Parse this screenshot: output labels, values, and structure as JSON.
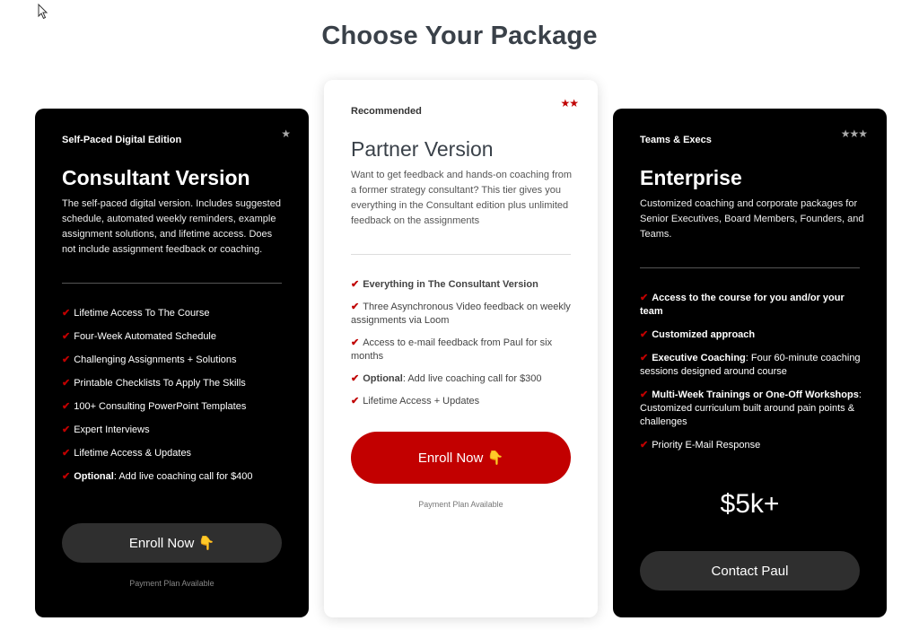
{
  "page": {
    "title": "Choose Your Package"
  },
  "colors": {
    "accent_red": "#c20000",
    "dark_card": "#000000",
    "button_gray": "#2f2f2f"
  },
  "cards": {
    "consultant": {
      "tier": "Self-Paced Digital Edition",
      "stars": "★",
      "title": "Consultant Version",
      "description": "The self-paced digital version. Includes suggested schedule, automated weekly reminders, example assignment solutions, and lifetime access. Does not include assignment feedback or coaching.",
      "features": [
        {
          "bold": "",
          "text": "Lifetime Access To The Course"
        },
        {
          "bold": "",
          "text": "Four-Week Automated Schedule"
        },
        {
          "bold": "",
          "text": "Challenging Assignments + Solutions"
        },
        {
          "bold": "",
          "text": "Printable Checklists To Apply The Skills"
        },
        {
          "bold": "",
          "text": "100+ Consulting PowerPoint Templates"
        },
        {
          "bold": "",
          "text": "Expert Interviews"
        },
        {
          "bold": "",
          "text": "Lifetime Access & Updates"
        },
        {
          "bold": "Optional",
          "text": ": Add live coaching call for $400"
        }
      ],
      "button": "Enroll Now 👇",
      "payment_note": "Payment Plan Available"
    },
    "partner": {
      "tier": "Recommended",
      "stars": "★★",
      "title": "Partner Version",
      "description": "Want to get feedback and hands-on coaching from a former strategy consultant? This tier gives you everything in the Consultant edition plus unlimited feedback on the assignments",
      "features": [
        {
          "bold": "Everything in The Consultant Version",
          "text": ""
        },
        {
          "bold": "",
          "text": "Three Asynchronous Video feedback on weekly assignments via Loom"
        },
        {
          "bold": "",
          "text": "Access to e-mail feedback from Paul for six months"
        },
        {
          "bold": "Optional",
          "text": ": Add live coaching call for $300"
        },
        {
          "bold": "",
          "text": "Lifetime Access + Updates"
        }
      ],
      "button": "Enroll Now 👇",
      "payment_note": "Payment Plan Available"
    },
    "enterprise": {
      "tier": "Teams & Execs",
      "stars": "★★★",
      "title": "Enterprise",
      "description": "Customized coaching and corporate packages for Senior Executives, Board Members, Founders, and Teams.",
      "features": [
        {
          "bold": "Access to the course for you and/or your team",
          "text": ""
        },
        {
          "bold": "Customized approach",
          "text": ""
        },
        {
          "bold": "Executive Coaching",
          "text": ": Four 60-minute coaching sessions designed around course"
        },
        {
          "bold": "Multi-Week Trainings or One-Off Workshops",
          "text": ": Customized curriculum built around pain points & challenges"
        },
        {
          "bold": "",
          "text": "Priority E-Mail Response"
        }
      ],
      "price": "$5k+",
      "button": "Contact Paul"
    }
  }
}
